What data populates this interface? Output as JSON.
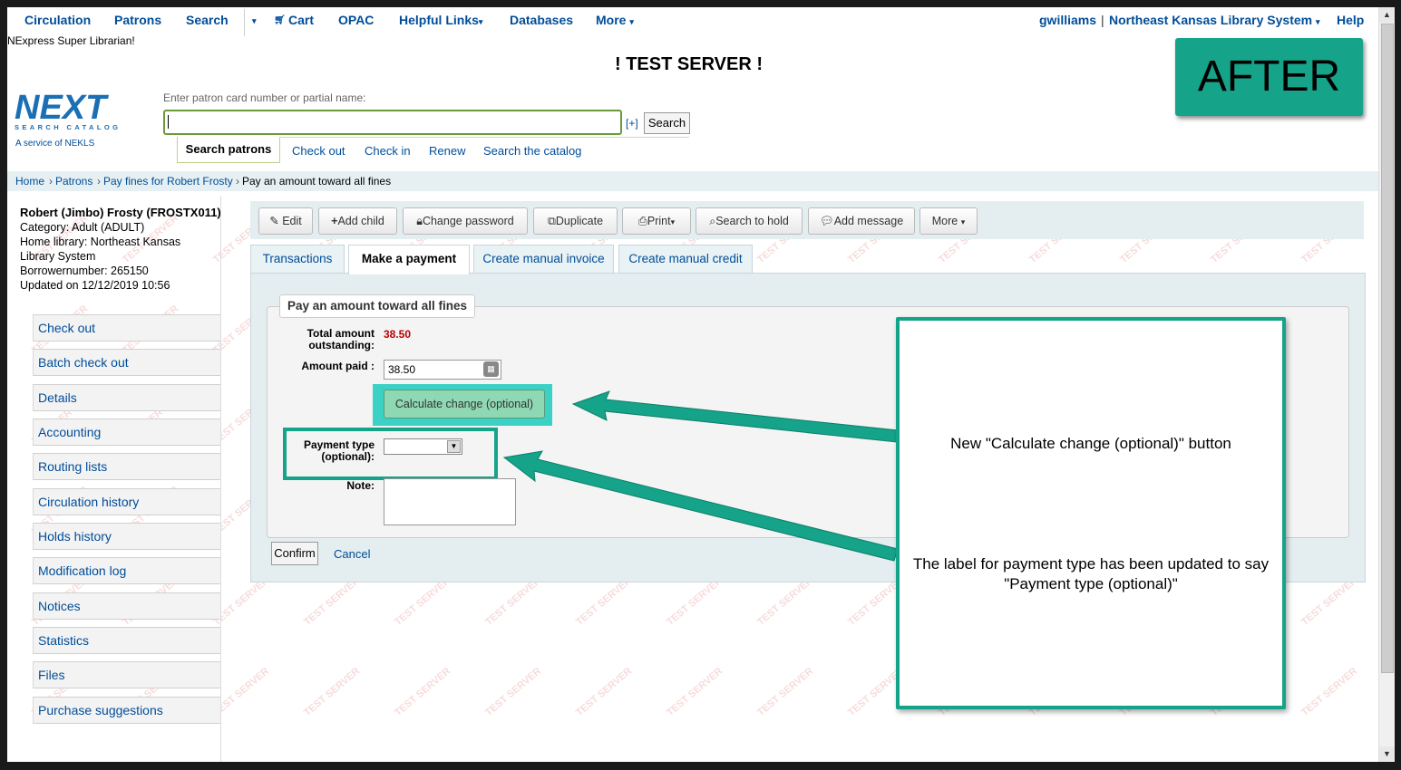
{
  "topnav": {
    "circulation": "Circulation",
    "patrons": "Patrons",
    "search": "Search",
    "cart": "Cart",
    "opac": "OPAC",
    "helpful_links": "Helpful Links",
    "databases": "Databases",
    "more": "More",
    "user": "gwilliams",
    "library": "Northeast Kansas Library System",
    "help": "Help"
  },
  "librarian": "NExpress Super Librarian!",
  "test_server": "! TEST SERVER !",
  "after_label": "AFTER",
  "logo": {
    "big": "NEXT",
    "small": "SEARCH CATALOG",
    "sub": "A service of NEKLS"
  },
  "patron_search": {
    "label": "Enter patron card number or partial name:",
    "value": "",
    "plus": "[+]",
    "search_button": "Search"
  },
  "search_tabs": [
    "Search patrons",
    "Check out",
    "Check in",
    "Renew",
    "Search the catalog"
  ],
  "breadcrumb": {
    "home": "Home",
    "patrons": "Patrons",
    "pay_fines": "Pay fines for Robert Frosty",
    "current": "Pay an amount toward all fines",
    "sep": "›"
  },
  "patron": {
    "name": "Robert (Jimbo) Frosty (FROSTX011)",
    "category": "Category: Adult (ADULT)",
    "home_library_1": "Home library: Northeast Kansas",
    "home_library_2": "Library System",
    "borrowernumber": "Borrowernumber: 265150",
    "updated": "Updated on 12/12/2019 10:56"
  },
  "left_nav": [
    "Check out",
    "Batch check out",
    "Details",
    "Accounting",
    "Routing lists",
    "Circulation history",
    "Holds history",
    "Modification log",
    "Notices",
    "Statistics",
    "Files",
    "Purchase suggestions"
  ],
  "toolbar": {
    "edit": "Edit",
    "add_child": "Add child",
    "change_password": "Change password",
    "duplicate": "Duplicate",
    "print": "Print",
    "search_to_hold": "Search to hold",
    "add_message": "Add message",
    "more": "More"
  },
  "tabs": [
    "Transactions",
    "Make a payment",
    "Create manual invoice",
    "Create manual credit"
  ],
  "form": {
    "legend": "Pay an amount toward all fines",
    "total_label_1": "Total amount",
    "total_label_2": "outstanding:",
    "total_value": "38.50",
    "amount_paid_label": "Amount paid :",
    "amount_paid_value": "38.50",
    "calc_button": "Calculate change (optional)",
    "payment_type_label_1": "Payment type",
    "payment_type_label_2": "(optional):",
    "payment_type_value": "",
    "note_label": "Note:",
    "confirm": "Confirm",
    "cancel": "Cancel"
  },
  "callout": {
    "text1": "New \"Calculate change (optional)\" button",
    "text2": "The label for payment type has been updated to say \"Payment type (optional)\""
  },
  "watermark": "TEST SERVER",
  "colors": {
    "accent": "#15a38a",
    "link": "#004d99",
    "highlight": "#3cd1c5"
  }
}
